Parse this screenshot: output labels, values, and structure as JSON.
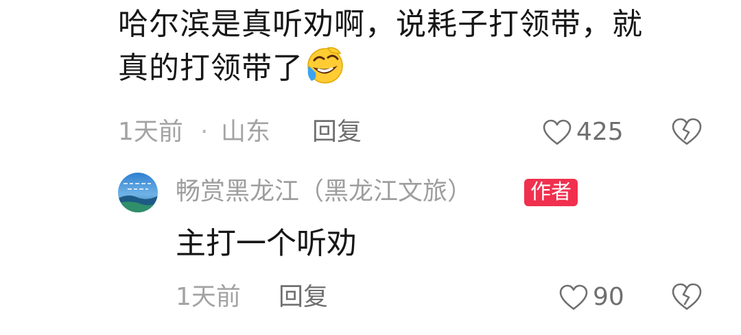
{
  "comment": {
    "line1": "哈尔滨是真听劝啊，说耗子打领带，就",
    "line2": "真的打领带了",
    "emoji": "laughing-crying-emoji",
    "time": "1天前",
    "separator": "·",
    "location": "山东",
    "reply_label": "回复",
    "like_count": "425"
  },
  "reply": {
    "author": "畅赏黑龙江（黑龙江文旅）",
    "badge": "作者",
    "text": "主打一个听劝",
    "time": "1天前",
    "reply_label": "回复",
    "like_count": "90"
  },
  "icons": {
    "like": "heart-outline-icon",
    "dislike": "broken-heart-icon"
  },
  "colors": {
    "badge": "#f0304e",
    "muted_text": "#a3a3a3",
    "action_text": "#6f6f6f",
    "primary_text": "#161616"
  }
}
